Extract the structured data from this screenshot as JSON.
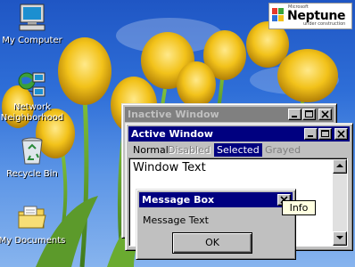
{
  "desktop": {
    "icons": [
      {
        "label": "My Computer",
        "icon": "computer-icon"
      },
      {
        "label": "Network\nNeighborhood",
        "icon": "network-icon"
      },
      {
        "label": "Recycle Bin",
        "icon": "recycle-bin-icon"
      },
      {
        "label": "My Documents",
        "icon": "folder-icon"
      }
    ],
    "logo": {
      "brand": "Neptune",
      "top_text": "Microsoft",
      "bottom_text": "under construction"
    }
  },
  "inactive_window": {
    "title": "Inactive Window"
  },
  "active_window": {
    "title": "Active Window",
    "menu": {
      "normal": "Normal",
      "disabled": "Disabled",
      "selected": "Selected",
      "grayed": "Grayed"
    },
    "window_text": "Window Text"
  },
  "message_box": {
    "title": "Message Box",
    "text": "Message Text",
    "ok_label": "OK"
  },
  "tooltip": {
    "text": "Info"
  },
  "colors": {
    "active_title": "#000080",
    "inactive_title": "#808080",
    "face": "#c0c0c0",
    "tooltip": "#ffffe1"
  }
}
